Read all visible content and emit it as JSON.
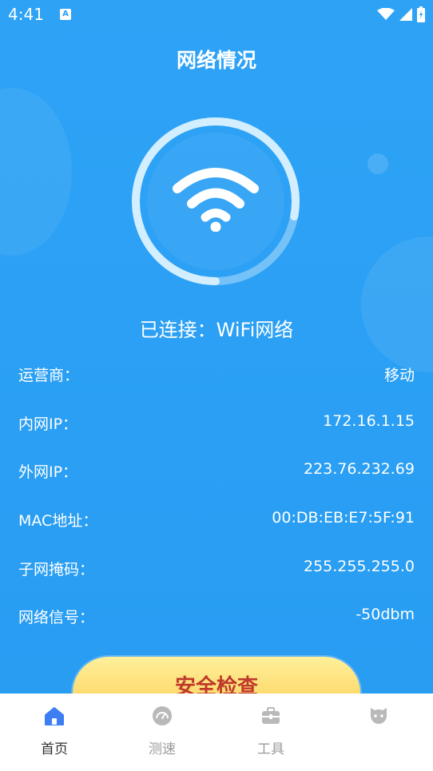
{
  "status_bar": {
    "time": "4:41",
    "notification_icon": "a-icon",
    "icons": [
      "wifi-icon",
      "signal-icon",
      "battery-icon"
    ]
  },
  "header": {
    "title": "网络情况"
  },
  "connection": {
    "status_text": "已连接：WiFi网络",
    "icon": "wifi-icon",
    "ring_progress": 0.78
  },
  "info": [
    {
      "label": "运营商：",
      "value": "移动"
    },
    {
      "label": "内网IP：",
      "value": "172.16.1.15"
    },
    {
      "label": "外网IP：",
      "value": "223.76.232.69"
    },
    {
      "label": "MAC地址：",
      "value": "00:DB:EB:E7:5F:91"
    },
    {
      "label": "子网掩码：",
      "value": "255.255.255.0"
    },
    {
      "label": "网络信号：",
      "value": "-50dbm"
    }
  ],
  "action_button": {
    "label": "安全检查"
  },
  "tabs": [
    {
      "label": "首页",
      "icon": "home-icon",
      "active": true
    },
    {
      "label": "测速",
      "icon": "speedometer-icon",
      "active": false
    },
    {
      "label": "工具",
      "icon": "toolbox-icon",
      "active": false
    },
    {
      "label": "",
      "icon": "face-icon",
      "active": false
    }
  ],
  "colors": {
    "background": "#2aa1f5",
    "accent": "#3d7ff2",
    "button_text": "#c0392b",
    "button_fill": "#f9c94a"
  }
}
